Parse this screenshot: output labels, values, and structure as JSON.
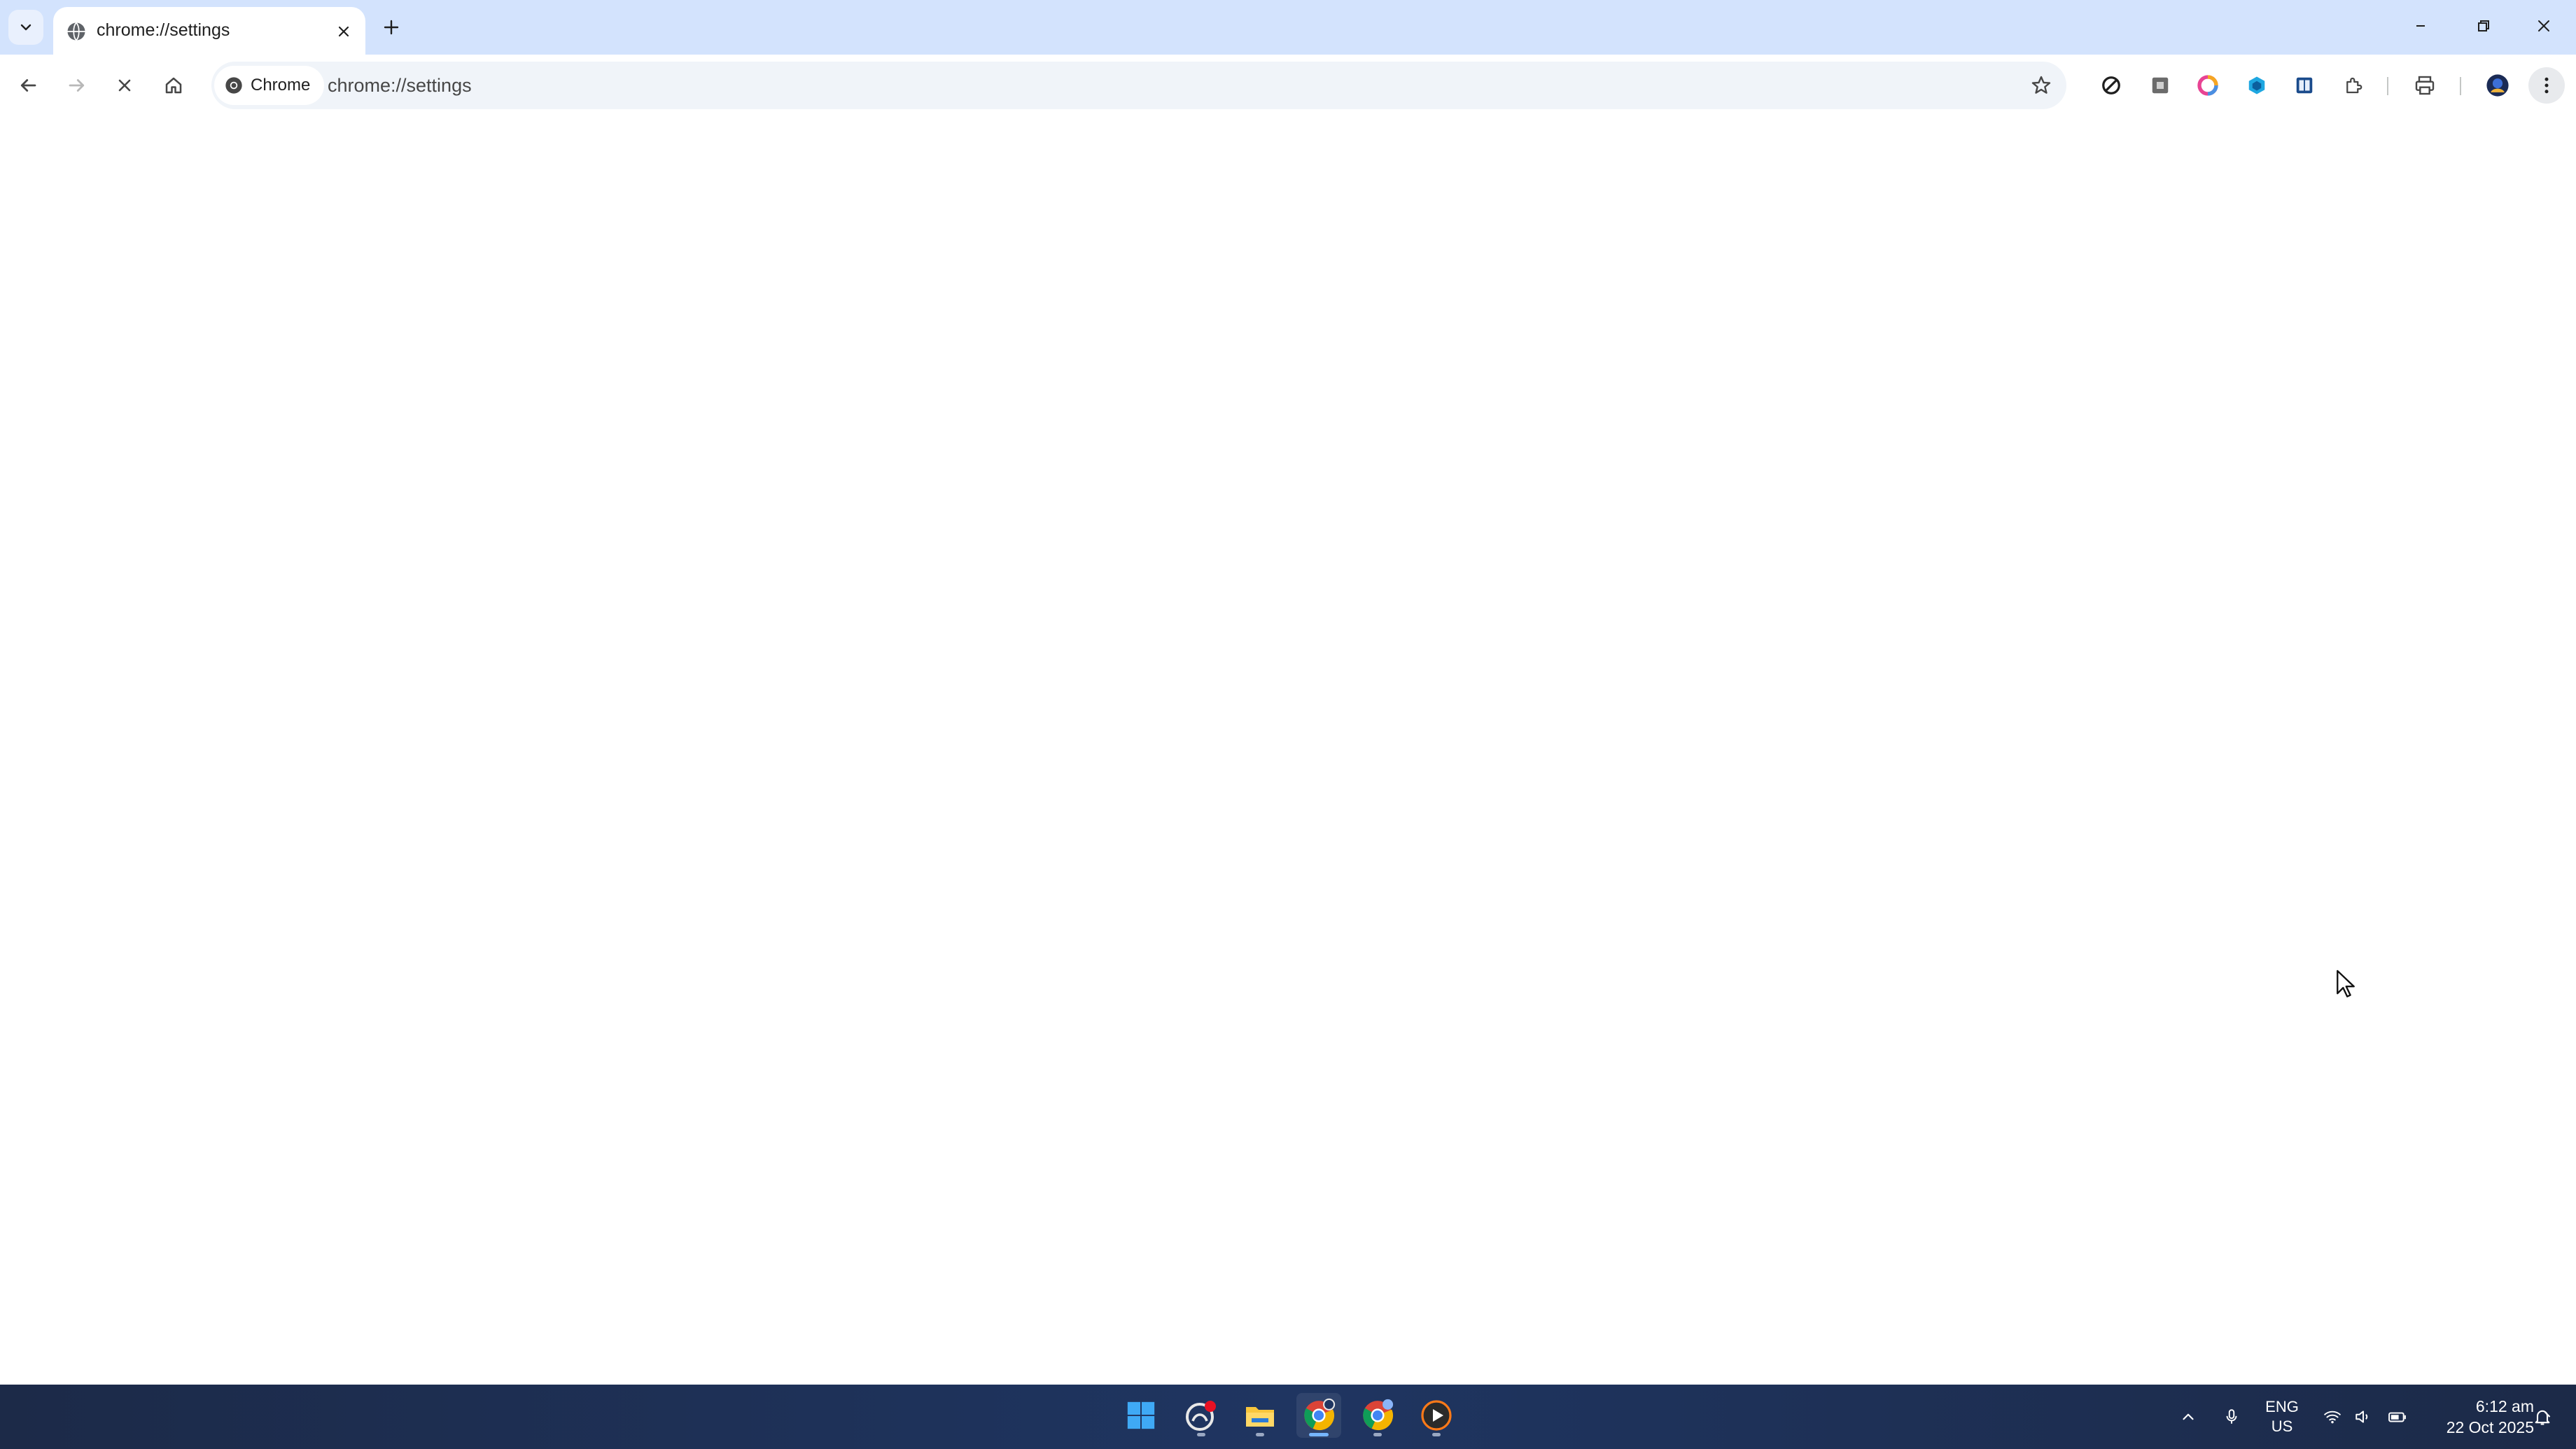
{
  "window": {
    "tab_title": "chrome://settings",
    "tab_favicon": "globe-icon",
    "controls": [
      "minimize-icon",
      "restore-icon",
      "close-icon"
    ]
  },
  "toolbar": {
    "chip_label": "Chrome",
    "url": "chrome://settings",
    "loading": true,
    "extensions": [
      "block-icon",
      "extension-gray-icon",
      "extension-color-ring-icon",
      "extension-blue-icon",
      "extension-book-icon",
      "puzzle-icon",
      "print-icon",
      "profile-avatar-icon",
      "more-vert-icon"
    ]
  },
  "taskbar": {
    "apps": [
      "windows-start-icon",
      "app-notification-icon",
      "file-explorer-icon",
      "chrome-icon",
      "chrome-badge-icon",
      "media-player-icon"
    ],
    "lang_line1": "ENG",
    "lang_line2": "US",
    "time": "6:12 am",
    "date": "22 Oct 2025"
  },
  "colors": {
    "tabstrip_bg": "#d3e3fd",
    "omnibox_bg": "#f0f4f9",
    "taskbar_bg": "#1f3561"
  }
}
